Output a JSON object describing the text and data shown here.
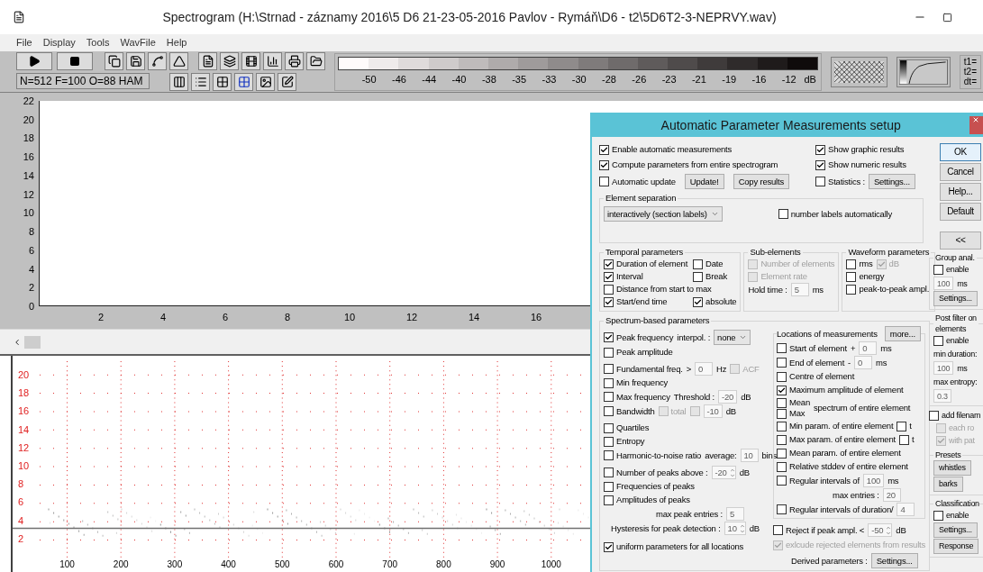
{
  "window": {
    "title": "Spectrogram (H:\\Strnad - záznamy 2016\\5 D6 21-23-05-2016 Pavlov - Rymáň\\D6 - t2\\5D6T2-3-NEPRVY.wav)"
  },
  "menu": [
    "File",
    "Display",
    "Tools",
    "WavFile",
    "Help"
  ],
  "toolbar": {
    "status": "N=512 F=100 O=88 HAM",
    "scale_labels": [
      "-50",
      "-46",
      "-44",
      "-40",
      "-38",
      "-35",
      "-33",
      "-30",
      "-28",
      "-26",
      "-23",
      "-21",
      "-19",
      "-16",
      "-12"
    ],
    "scale_unit": "dB",
    "cursor_labels": [
      "t1=",
      "t2=",
      "dt="
    ]
  },
  "top_plot": {
    "y_ticks": [
      "22",
      "20",
      "18",
      "16",
      "14",
      "12",
      "10",
      "8",
      "6",
      "4",
      "2",
      "0"
    ],
    "x_ticks": [
      "2",
      "4",
      "6",
      "8",
      "10",
      "12",
      "14",
      "16"
    ]
  },
  "spectrogram": {
    "y_ticks": [
      "20",
      "18",
      "16",
      "14",
      "12",
      "10",
      "8",
      "6",
      "4",
      "2"
    ],
    "x_ticks": [
      "100",
      "200",
      "300",
      "400",
      "500",
      "600",
      "700",
      "800",
      "900",
      "1000"
    ]
  },
  "dialog": {
    "title": "Automatic Parameter Measurements setup",
    "general": [
      {
        "kind": "check",
        "label": "Enable automatic measurements",
        "checked": true
      },
      {
        "kind": "check",
        "label": "Compute parameters from entire spectrogram",
        "checked": true
      },
      {
        "kind": "check",
        "label": "Automatic update",
        "checked": false,
        "after": [
          {
            "kind": "button",
            "label": "Update!"
          },
          {
            "kind": "button",
            "label": "Copy results"
          }
        ]
      }
    ],
    "results": [
      {
        "kind": "check",
        "label": "Show graphic results",
        "checked": true
      },
      {
        "kind": "check",
        "label": "Show numeric results",
        "checked": true
      },
      {
        "kind": "check",
        "label": "Statistics :",
        "checked": false,
        "after": [
          {
            "kind": "button",
            "label": "Settings..."
          }
        ]
      }
    ],
    "element_separation": {
      "title": "Element separation",
      "select": {
        "kind": "select",
        "value": "interactively (section labels)"
      },
      "check": {
        "kind": "check",
        "label": "number labels automatically",
        "checked": false
      }
    },
    "temporal": {
      "title": "Temporal parameters",
      "rows": [
        {
          "kind": "check",
          "label": "Duration of element",
          "checked": true,
          "after": [
            {
              "kind": "check",
              "label": "Date",
              "checked": false
            }
          ]
        },
        {
          "kind": "check",
          "label": "Interval",
          "checked": true,
          "after": [
            {
              "kind": "check",
              "label": "Break",
              "checked": false
            }
          ]
        },
        {
          "kind": "check",
          "label": "Distance from start to max",
          "checked": false
        },
        {
          "kind": "check",
          "label": "Start/end time",
          "checked": true,
          "after": [
            {
              "kind": "check",
              "label": "absolute",
              "checked": true
            }
          ]
        }
      ]
    },
    "sub_elements": {
      "title": "Sub-elements",
      "rows": [
        {
          "kind": "check",
          "label": "Number of elements",
          "checked": false,
          "disabled": true
        },
        {
          "kind": "check",
          "label": "Element rate",
          "checked": false,
          "disabled": true
        },
        {
          "kind": "text",
          "text": "Hold time :",
          "after": [
            {
              "kind": "field",
              "value": "5"
            },
            {
              "kind": "text",
              "text": "ms"
            }
          ]
        }
      ]
    },
    "waveform": {
      "title": "Waveform parameters",
      "rows": [
        {
          "kind": "check",
          "label": "rms",
          "checked": false,
          "disabled": false,
          "after": [
            {
              "kind": "check",
              "label": "dB",
              "checked": true,
              "disabled": true
            }
          ]
        },
        {
          "kind": "check",
          "label": "energy",
          "checked": false
        },
        {
          "kind": "check",
          "label": "peak-to-peak ampl.",
          "checked": false
        }
      ]
    },
    "spectrum": {
      "title": "Spectrum-based parameters",
      "rows": [
        {
          "kind": "check",
          "label": "Peak frequency",
          "checked": true,
          "after": [
            {
              "kind": "text",
              "text": "interpol. :"
            },
            {
              "kind": "select",
              "value": "none"
            }
          ]
        },
        {
          "kind": "check",
          "label": "Peak amplitude",
          "checked": false
        },
        {
          "kind": "check",
          "label": "Fundamental freq.",
          "checked": false,
          "after": [
            {
              "kind": "text",
              "text": ">"
            },
            {
              "kind": "field",
              "value": "0"
            },
            {
              "kind": "text",
              "text": "Hz"
            },
            {
              "kind": "check",
              "label": "ACF",
              "checked": false,
              "disabled": true
            }
          ]
        },
        {
          "kind": "check",
          "label": "Min frequency",
          "checked": false
        },
        {
          "kind": "check",
          "label": "Max frequency",
          "checked": false,
          "after": [
            {
              "kind": "text",
              "text": "Threshold :"
            },
            {
              "kind": "field",
              "value": "-20"
            },
            {
              "kind": "text",
              "text": "dB"
            }
          ]
        },
        {
          "kind": "check",
          "label": "Bandwidth",
          "checked": false,
          "disabled": false,
          "after": [
            {
              "kind": "check",
              "label": "total",
              "checked": false,
              "disabled": true
            },
            {
              "kind": "check",
              "checked": false,
              "disabled": true
            },
            {
              "kind": "field",
              "value": "-10"
            },
            {
              "kind": "text",
              "text": "dB"
            }
          ]
        },
        {
          "kind": "check",
          "label": "Quartiles",
          "checked": false
        },
        {
          "kind": "check",
          "label": "Entropy",
          "checked": false
        },
        {
          "kind": "check",
          "label": "Harmonic-to-noise ratio",
          "checked": false,
          "after": [
            {
              "kind": "text",
              "text": "average:"
            },
            {
              "kind": "field",
              "value": "10"
            },
            {
              "kind": "text",
              "text": "bins"
            }
          ]
        },
        {
          "kind": "check",
          "label": "Number of peaks above :",
          "checked": false,
          "after": [
            {
              "kind": "spin",
              "value": "-20"
            },
            {
              "kind": "text",
              "text": "dB"
            }
          ]
        },
        {
          "kind": "check",
          "label": "Frequencies of peaks",
          "checked": false
        },
        {
          "kind": "check",
          "label": "Amplitudes of peaks",
          "checked": false
        },
        {
          "kind": "text",
          "text": "max peak entries :",
          "after": [
            {
              "kind": "field",
              "value": "5"
            }
          ]
        },
        {
          "kind": "text",
          "text": "Hysteresis for peak detection :",
          "after": [
            {
              "kind": "spin",
              "value": "10"
            },
            {
              "kind": "text",
              "text": "dB"
            }
          ]
        },
        {
          "kind": "check",
          "label": "uniform parameters for all locations",
          "checked": true
        }
      ]
    },
    "locations": {
      "title": "Locations of measurements",
      "button": "more...",
      "rows": [
        {
          "kind": "check",
          "label": "Start of element",
          "checked": false,
          "after": [
            {
              "kind": "text",
              "text": "+"
            },
            {
              "kind": "field",
              "value": "0"
            },
            {
              "kind": "text",
              "text": "ms"
            }
          ]
        },
        {
          "kind": "check",
          "label": "End of element",
          "checked": false,
          "after": [
            {
              "kind": "text",
              "text": "-"
            },
            {
              "kind": "field",
              "value": "0"
            },
            {
              "kind": "text",
              "text": "ms"
            }
          ]
        },
        {
          "kind": "check",
          "label": "Centre of element",
          "checked": false
        },
        {
          "kind": "check",
          "label": "Maximum amplitude of element",
          "checked": true
        },
        {
          "kind": "stack",
          "items": [
            {
              "kind": "check",
              "label": "Mean",
              "checked": false
            },
            {
              "kind": "check",
              "label": "Max",
              "checked": false
            }
          ],
          "after": [
            {
              "kind": "text",
              "text": "spectrum of entire element"
            }
          ]
        },
        {
          "kind": "check",
          "label": "Min param. of entire element",
          "checked": false,
          "after": [
            {
              "kind": "check",
              "label": "t",
              "checked": false
            }
          ]
        },
        {
          "kind": "check",
          "label": "Max param. of entire element",
          "checked": false,
          "after": [
            {
              "kind": "check",
              "label": "t",
              "checked": false
            }
          ]
        },
        {
          "kind": "check",
          "label": "Mean param. of entire element",
          "checked": false
        },
        {
          "kind": "check",
          "label": "Relative stddev of entire element",
          "checked": false
        },
        {
          "kind": "check",
          "label": "Regular intervals of",
          "checked": false,
          "after": [
            {
              "kind": "field",
              "value": "100"
            },
            {
              "kind": "text",
              "text": "ms"
            }
          ]
        },
        {
          "kind": "text",
          "text": "max entries :",
          "after": [
            {
              "kind": "field",
              "value": "20"
            }
          ]
        },
        {
          "kind": "check",
          "label": "Regular intervals of duration/",
          "checked": false,
          "after": [
            {
              "kind": "field",
              "value": "4"
            }
          ]
        }
      ]
    },
    "rejection": [
      {
        "kind": "check",
        "label": "Reject if peak ampl. <",
        "checked": false,
        "disabled": false,
        "after": [
          {
            "kind": "spin",
            "value": "-50"
          },
          {
            "kind": "text",
            "text": "dB"
          }
        ]
      },
      {
        "kind": "check",
        "label": "exlcude rejected elements from results",
        "checked": true,
        "disabled": true
      },
      {
        "kind": "text",
        "text": "Derived parameters :",
        "after": [
          {
            "kind": "button",
            "label": "Settings..."
          }
        ]
      }
    ],
    "buttons": [
      {
        "label": "OK",
        "focused": true
      },
      {
        "label": "Cancel",
        "focused": false
      },
      {
        "label": "Help...",
        "focused": false
      },
      {
        "label": "Default",
        "focused": false
      },
      {
        "label": "<<",
        "focused": false
      }
    ],
    "side": [
      {
        "title": "Group anal.",
        "rows": [
          {
            "kind": "check",
            "label": "enable",
            "checked": false
          },
          {
            "kind": "field",
            "value": "100",
            "after": [
              {
                "kind": "text",
                "text": "ms"
              }
            ]
          },
          {
            "kind": "button",
            "label": "Settings..."
          }
        ]
      },
      {
        "title": "Post filter on elements",
        "rows": [
          {
            "kind": "check",
            "label": "enable",
            "checked": false
          },
          {
            "kind": "text",
            "text": "min duration:"
          },
          {
            "kind": "field",
            "value": "100",
            "after": [
              {
                "kind": "text",
                "text": "ms"
              }
            ]
          },
          {
            "kind": "text",
            "text": "max entropy:"
          },
          {
            "kind": "field",
            "value": "0.3"
          }
        ]
      },
      {
        "rows": [
          {
            "kind": "check",
            "label": "add filenam",
            "checked": false,
            "disabled": false
          },
          {
            "kind": "check",
            "label": "each ro",
            "checked": false,
            "disabled": true
          },
          {
            "kind": "check",
            "label": "with pat",
            "checked": true,
            "disabled": true
          }
        ]
      },
      {
        "title": "Presets",
        "rows": [
          {
            "kind": "button",
            "label": "whistles"
          },
          {
            "kind": "button",
            "label": "barks"
          }
        ]
      },
      {
        "title": "Classification",
        "rows": [
          {
            "kind": "check",
            "label": "enable",
            "checked": false
          },
          {
            "kind": "button",
            "label": "Settings..."
          },
          {
            "kind": "button",
            "label": "Response"
          }
        ]
      }
    ]
  }
}
